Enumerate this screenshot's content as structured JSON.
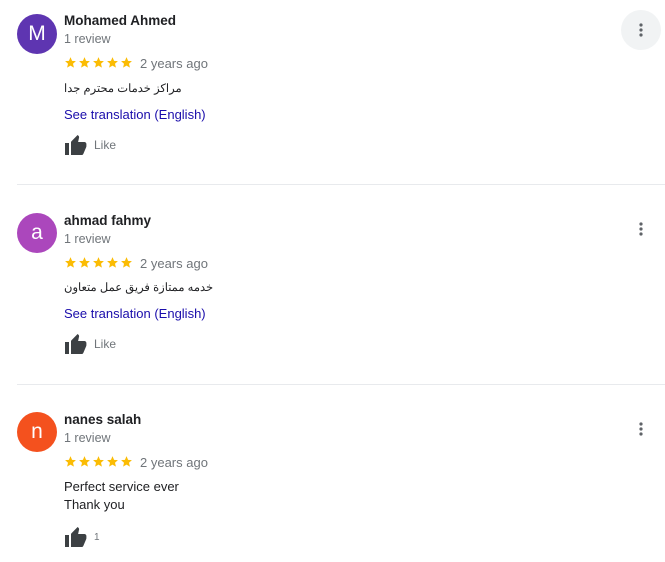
{
  "colors": {
    "star": "#fbbc04",
    "link": "#1a0dab"
  },
  "icons": {
    "rating": "star-icon",
    "like": "thumbs-up-icon",
    "menu": "more-vert-icon"
  },
  "reviews": [
    {
      "initial": "M",
      "avatar_color": "#5e35b1",
      "name": "Mohamed Ahmed",
      "review_count": "1 review",
      "rating": 5,
      "date": "2 years ago",
      "text": "مراكز خدمات محترم جدا",
      "translate_label": "See translation (English)",
      "like_label": "Like"
    },
    {
      "initial": "a",
      "avatar_color": "#ab47bc",
      "name": "ahmad fahmy",
      "review_count": "1 review",
      "rating": 5,
      "date": "2 years ago",
      "text": "خدمه ممتازة فريق عمل متعاون",
      "translate_label": "See translation (English)",
      "like_label": "Like"
    },
    {
      "initial": "n",
      "avatar_color": "#f4511e",
      "name": "nanes salah",
      "review_count": "1 review",
      "rating": 5,
      "date": "2 years ago",
      "text_line1": "Perfect service ever",
      "text_line2": "Thank you",
      "like_label": "1"
    }
  ]
}
